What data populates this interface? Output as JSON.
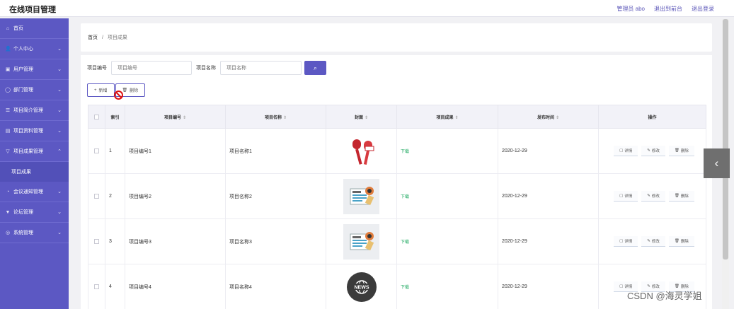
{
  "app": {
    "title": "在线项目管理"
  },
  "header": {
    "admin": "管理员 abo",
    "exit_front": "退出到前台",
    "logout": "退出登录"
  },
  "sidebar": {
    "items": [
      {
        "label": "首页",
        "icon": "⌂",
        "chev": ""
      },
      {
        "label": "个人中心",
        "icon": "👤",
        "chev": "⌄"
      },
      {
        "label": "用户管理",
        "icon": "▣",
        "chev": "⌄"
      },
      {
        "label": "部门管理",
        "icon": "◯",
        "chev": "⌄"
      },
      {
        "label": "项目简介管理",
        "icon": "☰",
        "chev": "⌄"
      },
      {
        "label": "项目资料管理",
        "icon": "▤",
        "chev": "⌄"
      },
      {
        "label": "项目成果管理",
        "icon": "▽",
        "chev": "⌃"
      }
    ],
    "sub_items": [
      {
        "label": "项目成果"
      }
    ],
    "items_after": [
      {
        "label": "会议通知管理",
        "icon": "◔",
        "chev": "⌄"
      },
      {
        "label": "论坛管理",
        "icon": "▼",
        "chev": "⌄"
      },
      {
        "label": "系统管理",
        "icon": "◎",
        "chev": "⌄"
      }
    ]
  },
  "breadcrumb": {
    "home": "首页",
    "sep": "/",
    "current": "项目成果"
  },
  "search": {
    "code_label": "项目编号",
    "code_placeholder": "项目编号",
    "name_label": "项目名称",
    "name_placeholder": "项目名称",
    "button_icon": "⌕"
  },
  "actions": {
    "add": "新增",
    "delete": "删除"
  },
  "table": {
    "headers": [
      "",
      "索引",
      "项目编号",
      "项目名称",
      "封面",
      "项目成果",
      "发布时间",
      "操作"
    ],
    "rows": [
      {
        "index": "1",
        "code": "项目编号1",
        "name": "项目名称1",
        "cover": "microphones",
        "result": "下载",
        "date": "2020-12-29"
      },
      {
        "index": "2",
        "code": "项目编号2",
        "name": "项目名称2",
        "cover": "newspaper",
        "result": "下载",
        "date": "2020-12-29"
      },
      {
        "index": "3",
        "code": "项目编号3",
        "name": "项目名称3",
        "cover": "newspaper",
        "result": "下载",
        "date": "2020-12-29"
      },
      {
        "index": "4",
        "code": "项目编号4",
        "name": "项目名称4",
        "cover": "news-globe",
        "result": "下载",
        "date": "2020-12-29"
      }
    ],
    "ops": {
      "detail": "详情",
      "edit": "修改",
      "delete": "删除"
    }
  },
  "watermark": "CSDN @海灵学姐",
  "colors": {
    "accent": "#5c58c3",
    "download": "#1ba85e"
  }
}
